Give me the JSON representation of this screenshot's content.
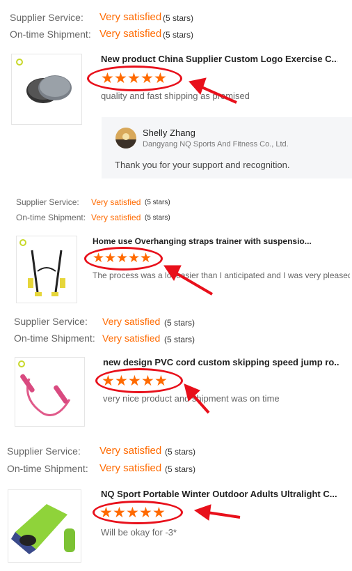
{
  "reviews": [
    {
      "supplier_label": "Supplier Service:",
      "supplier_value": "Very satisfied",
      "supplier_stars": "(5 stars)",
      "shipment_label": "On-time Shipment:",
      "shipment_value": "Very satisfied",
      "shipment_stars": "(5 stars)",
      "product_title": "New product China Supplier Custom Logo Exercise C...",
      "comment": "quality and fast shipping as promised",
      "rating": 5,
      "reply": {
        "name": "Shelly Zhang",
        "company": "Dangyang NQ Sports And Fitness Co., Ltd.",
        "text": "Thank you for your support and recognition."
      }
    },
    {
      "supplier_label": "Supplier Service:",
      "supplier_value": "Very satisfied",
      "supplier_stars": "(5 stars)",
      "shipment_label": "On-time Shipment:",
      "shipment_value": "Very satisfied",
      "shipment_stars": "(5 stars)",
      "product_title": "Home use Overhanging straps trainer with suspensio...",
      "comment": "The process was a lot easier than I anticipated and I was very pleased",
      "rating": 5
    },
    {
      "supplier_label": "Supplier Service:",
      "supplier_value": "Very satisfied",
      "supplier_stars": "(5 stars)",
      "shipment_label": "On-time Shipment:",
      "shipment_value": "Very satisfied",
      "shipment_stars": "(5 stars)",
      "product_title": "new design PVC cord custom skipping speed jump ro...",
      "comment": "very nice product and shipment was on time",
      "rating": 5
    },
    {
      "supplier_label": "Supplier Service:",
      "supplier_value": "Very satisfied",
      "supplier_stars": "(5 stars)",
      "shipment_label": "On-time Shipment:",
      "shipment_value": "Very satisfied",
      "shipment_stars": "(5 stars)",
      "product_title": "NQ Sport Portable Winter Outdoor Adults Ultralight C...",
      "comment": "Will be okay for -3*",
      "rating": 5
    }
  ],
  "colors": {
    "accent": "#ff6a00",
    "highlight": "#e8101b",
    "reply_bg": "#f5f6f8"
  },
  "icons": {
    "star": "star-icon",
    "annotation": "arrow-icon"
  }
}
